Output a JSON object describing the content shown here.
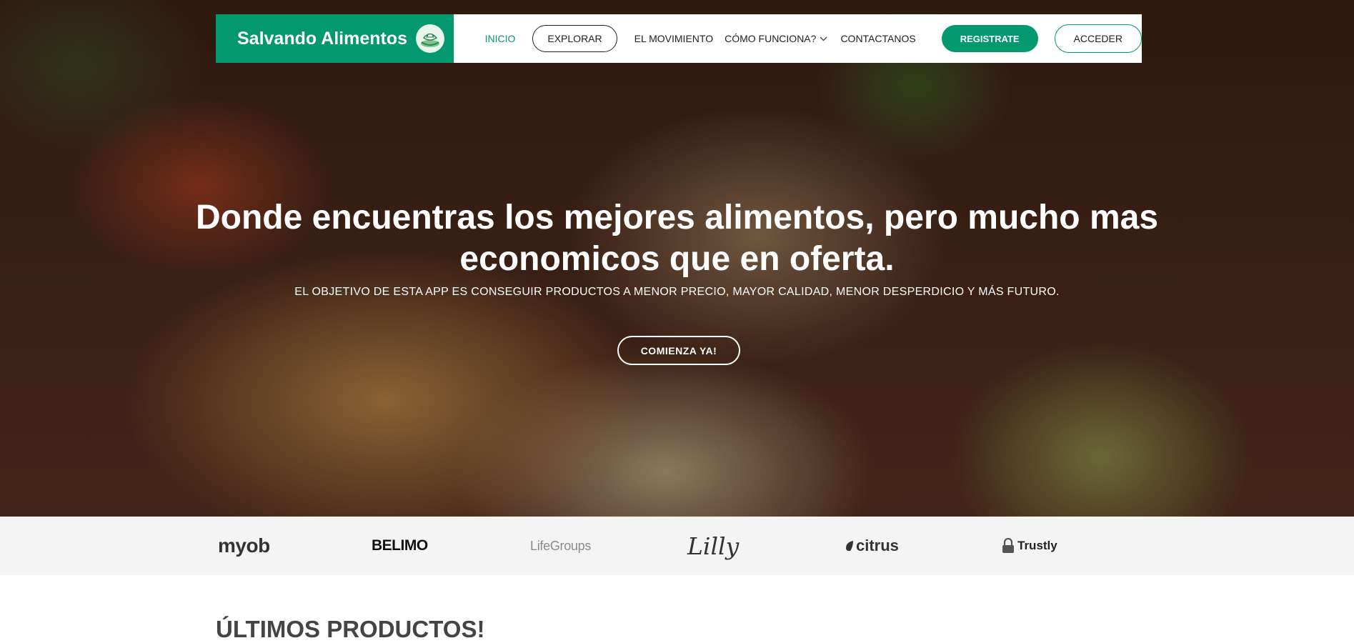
{
  "brand": {
    "name": "Salvando Alimentos",
    "logo_icon": "hands-leaf-icon",
    "color": "#03986d"
  },
  "nav": {
    "links": [
      {
        "label": "INICIO",
        "active": true
      },
      {
        "label": "EXPLORAR"
      },
      {
        "label": "EL MOVIMIENTO"
      },
      {
        "label": "CÓMO FUNCIONA?",
        "icon": "chevron-down-icon"
      },
      {
        "label": "CONTACTANOS"
      }
    ],
    "register_label": "REGISTRATE",
    "login_label": "ACCEDER"
  },
  "hero": {
    "title": "Donde encuentras los mejores alimentos, pero mucho mas economicos que en oferta.",
    "subtitle": "EL OBJETIVO DE ESTA APP ES CONSEGUIR PRODUCTOS A MENOR PRECIO, MAYOR CALIDAD, MENOR DESPERDICIO Y MÁS FUTURO.",
    "cta_label": "COMIENZA YA!"
  },
  "clients": [
    "myob",
    "BELIMO",
    "LifeGroups",
    "Lilly",
    "citrus",
    "Trustly"
  ],
  "products": {
    "title": "ÚLTIMOS PRODUCTOS!"
  },
  "colors": {
    "accent": "#03986d",
    "client_bar": "#f4f4f5"
  }
}
